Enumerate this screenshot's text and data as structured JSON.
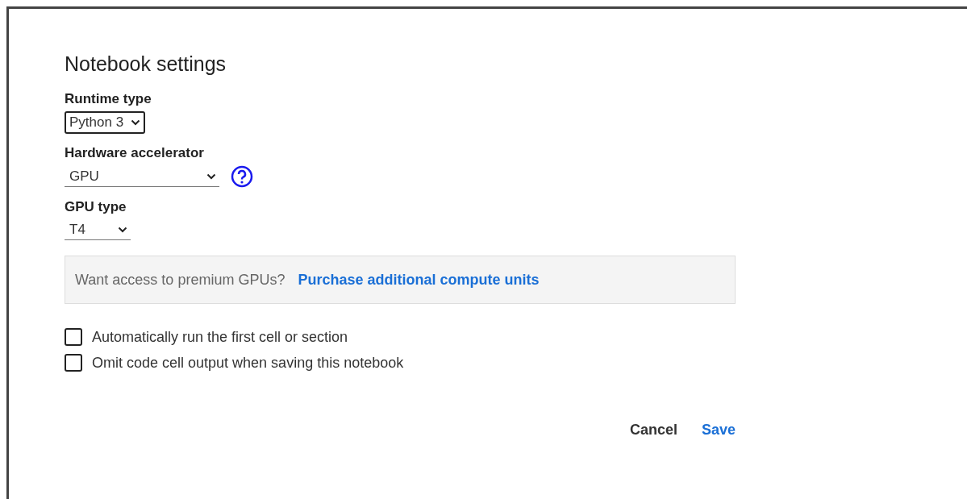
{
  "dialog": {
    "title": "Notebook settings",
    "fields": [
      {
        "kind": "boxed-select",
        "label": "Runtime type",
        "value": "Python 3",
        "help": false
      },
      {
        "kind": "underline-select",
        "label": "Hardware accelerator",
        "value": "GPU",
        "help": true
      },
      {
        "kind": "underline-select",
        "label": "GPU type",
        "value": "T4",
        "help": false
      }
    ],
    "promo": {
      "text": "Want access to premium GPUs?",
      "link": "Purchase additional compute units"
    },
    "checkboxes": [
      {
        "label": "Automatically run the first cell or section",
        "checked": false
      },
      {
        "label": "Omit code cell output when saving this notebook",
        "checked": false
      }
    ],
    "buttons": [
      {
        "label": "Cancel",
        "kind": "plain"
      },
      {
        "label": "Save",
        "kind": "primary"
      }
    ]
  }
}
